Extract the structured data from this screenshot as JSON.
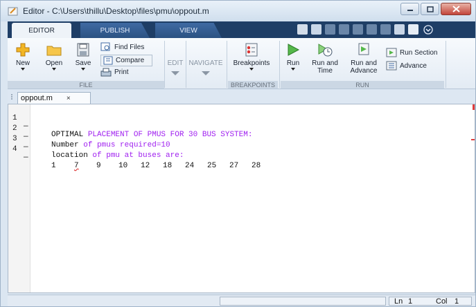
{
  "window": {
    "title": "Editor - C:\\Users\\thillu\\Desktop\\files\\pmu\\oppout.m",
    "controls": {
      "minimize": "minimize-icon",
      "maximize": "maximize-icon",
      "close": "close-icon"
    }
  },
  "toolstrip": {
    "tabs": [
      {
        "label": "EDITOR",
        "active": true
      },
      {
        "label": "PUBLISH",
        "active": false
      },
      {
        "label": "VIEW",
        "active": false
      }
    ]
  },
  "ribbon": {
    "file": {
      "group_label": "FILE",
      "new_label": "New",
      "open_label": "Open",
      "save_label": "Save",
      "find_files_label": "Find Files",
      "compare_label": "Compare",
      "print_label": "Print"
    },
    "edit": {
      "label": "EDIT"
    },
    "navigate": {
      "label": "NAVIGATE"
    },
    "breakpoints": {
      "group_label": "BREAKPOINTS",
      "button_label": "Breakpoints"
    },
    "run": {
      "group_label": "RUN",
      "run_label": "Run",
      "run_and_time_line1": "Run and",
      "run_and_time_line2": "Time",
      "run_and_advance_line1": "Run and",
      "run_and_advance_line2": "Advance",
      "run_section_label": "Run Section",
      "advance_label": "Advance"
    }
  },
  "document_tab": {
    "label": "oppout.m",
    "close": "×"
  },
  "editor": {
    "lines": [
      {
        "num": "1",
        "dash": "—",
        "plain": "OPTIMAL ",
        "str": "PLACEMENT OF PMUS FOR 30 BUS SYSTEM:"
      },
      {
        "num": "2",
        "dash": "—",
        "plain": "Number ",
        "str": "of pmus required=10"
      },
      {
        "num": "3",
        "dash": "—",
        "plain": "location ",
        "str": "of pmu at buses are:"
      },
      {
        "num": "4",
        "dash": "—",
        "values": [
          "1",
          "7",
          "9",
          "10",
          "12",
          "18",
          "24",
          "25",
          "27",
          "28"
        ]
      }
    ]
  },
  "statusbar": {
    "ln_label": "Ln",
    "ln_value": "1",
    "col_label": "Col",
    "col_value": "1"
  }
}
